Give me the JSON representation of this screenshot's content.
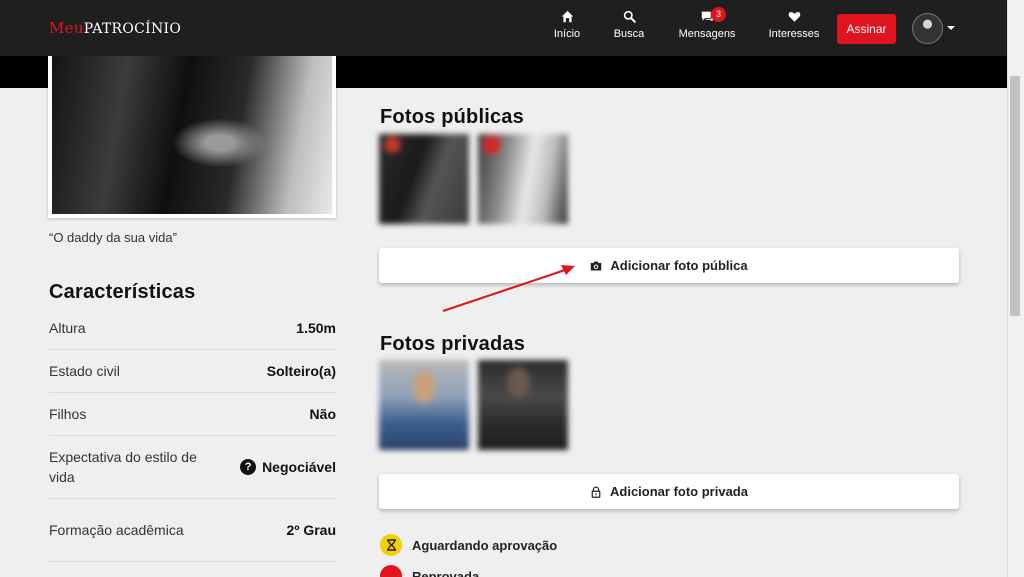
{
  "brand": {
    "meu": "Meu",
    "rest": "Patrocínio"
  },
  "nav": {
    "items": [
      {
        "label": "Início",
        "icon": "home-icon"
      },
      {
        "label": "Busca",
        "icon": "search-icon"
      },
      {
        "label": "Mensagens",
        "icon": "chat-icon",
        "badge": "3"
      },
      {
        "label": "Interesses",
        "icon": "heart-icon"
      }
    ],
    "subscribe_label": "Assinar"
  },
  "profile": {
    "quote": "“O daddy da sua vida”",
    "characteristics_title": "Características",
    "characteristics": [
      {
        "label": "Altura",
        "value": "1.50m"
      },
      {
        "label": "Estado civil",
        "value": "Solteiro(a)"
      },
      {
        "label": "Filhos",
        "value": "Não"
      },
      {
        "label": "Expectativa do estilo de vida",
        "value": "Negociável",
        "icon": "question-circle-icon"
      },
      {
        "label": "Formação acadêmica",
        "value": "2º Grau"
      }
    ]
  },
  "photos": {
    "public_title": "Fotos públicas",
    "add_public_label": "Adicionar foto pública",
    "private_title": "Fotos privadas",
    "add_private_label": "Adicionar foto privada",
    "status_pending": "Aguardando aprovação",
    "status_rejected_partial": "Reprovada"
  },
  "colors": {
    "brand_red": "#e0141e",
    "nav_bg": "#1f1f1f",
    "page_bg": "#efefef",
    "pending_yellow": "#f5d000"
  }
}
